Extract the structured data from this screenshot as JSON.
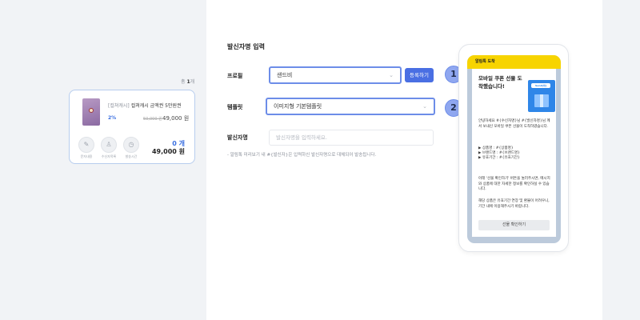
{
  "cart": {
    "count_prefix": "총",
    "count_value": "1",
    "count_suffix": "개",
    "product": {
      "brand": "[컬쳐캐시]",
      "name": "컬쳐캐시 금액권 5만원권",
      "discount": "2%",
      "original_price": "50,000 원",
      "price": "49,000 원"
    },
    "actions": [
      {
        "icon": "edit-icon",
        "glyph": "✎",
        "label": "문자내용"
      },
      {
        "icon": "user-icon",
        "glyph": "♙",
        "label": "수신자목록"
      },
      {
        "icon": "clock-icon",
        "glyph": "◷",
        "label": "발송시간"
      }
    ],
    "quantity": "0 개",
    "total": "49,000 원"
  },
  "form": {
    "title": "발신자명 입력",
    "profile_label": "프로필",
    "profile_value": "샌드비",
    "register_button": "등록하기",
    "template_label": "템플릿",
    "template_value": "이미지형 기본템플릿",
    "sender_label": "발신자명",
    "sender_placeholder": "발신자명을 입력하세요.",
    "note": "- 알림톡 미리보기 내 #{발신자}은 입력하신 발신자명으로 대체되어 발송됩니다."
  },
  "steps": [
    "1",
    "2"
  ],
  "preview": {
    "header": "알림톡 도착",
    "title": "모바일 쿠폰 선물 도착했습니다!",
    "gift_tag": "Send[아]",
    "greeting": "안녕하세요 #{수신자명}님 #{발신자명}님 께서 보내신 모바일 쿠폰 선물이 도착하였습니다.",
    "item_name": "▶ 상품명 : #{상품명}",
    "item_brand": "▶ 브랜드명 : #{브랜드명}",
    "item_expiry": "▶ 유효기간 : #{유효기간}",
    "guide": "아래 '선물 확인하기' 버튼을 눌러주시면, 메시지와 상품에 대한 자세한 정보를 확인하실 수 있습니다.",
    "warning": "해당 상품은 유효기간 연장 및 환불이 어려우니, 기간 내에 이용해주시기 바랍니다.",
    "button": "선물 확인하기"
  },
  "colors": {
    "accent": "#4a6fe3",
    "highlight_border": "#6d8de8",
    "kakao_yellow": "#f7d400",
    "chat_bg": "#bccadb"
  }
}
